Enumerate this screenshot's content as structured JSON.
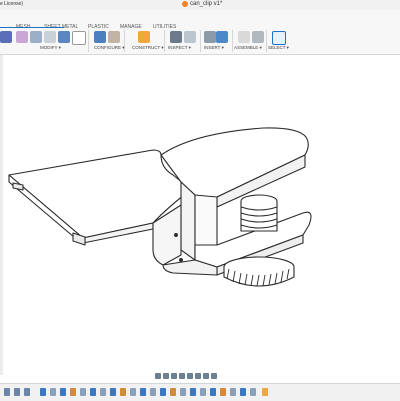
{
  "title_bar": {
    "license_text": "e License)",
    "document_name": "can_clip v1*"
  },
  "ribbon": {
    "tabs": [
      "MESH",
      "SHEET METAL",
      "PLASTIC",
      "MANAGE",
      "UTILITIES"
    ],
    "groups": [
      "MODIFY ▾",
      "CONFIGURE ▾",
      "CONSTRUCT ▾",
      "INSPECT ▾",
      "INSERT ▾",
      "ASSEMBLE ▾",
      "SELECT ▾"
    ]
  },
  "colors": {
    "accent": "#1a73c8",
    "doc_icon": "#f5821f",
    "model_stroke": "#2b2b2b"
  }
}
